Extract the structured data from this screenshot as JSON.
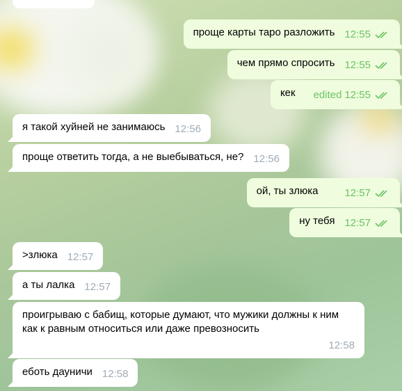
{
  "colors": {
    "incoming_bubble": "#ffffff",
    "outgoing_bubble": "#effdde",
    "outgoing_meta": "#6cc264",
    "incoming_meta": "#a0acb6"
  },
  "messages": [
    {
      "dir": "out",
      "text": "проще карты таро разложить",
      "time": "12:55",
      "status_icon": "double-check-icon"
    },
    {
      "dir": "out",
      "text": "чем прямо спросить",
      "time": "12:55",
      "status_icon": "double-check-icon"
    },
    {
      "dir": "out",
      "text": "кек",
      "edited_label": "edited",
      "time": "12:55",
      "status_icon": "double-check-icon"
    },
    {
      "dir": "in",
      "text": "я такой хуйней не занимаюсь",
      "time": "12:56"
    },
    {
      "dir": "in",
      "text": "проще ответить тогда, а не выебываться, не?",
      "time": "12:56"
    },
    {
      "dir": "out",
      "text": "ой, ты злюка",
      "time": "12:57",
      "status_icon": "double-check-icon"
    },
    {
      "dir": "out",
      "text": "ну тебя",
      "time": "12:57",
      "status_icon": "double-check-icon"
    },
    {
      "dir": "in",
      "text": ">злюка",
      "time": "12:57"
    },
    {
      "dir": "in",
      "text": "а ты лалка",
      "time": "12:57"
    },
    {
      "dir": "in",
      "text": "проигрываю с бабищ, которые думают, что мужики должны к ним как к равным относиться или даже превозносить",
      "time": "12:58"
    },
    {
      "dir": "in",
      "text": "еботь дауничи",
      "time": "12:58"
    }
  ]
}
